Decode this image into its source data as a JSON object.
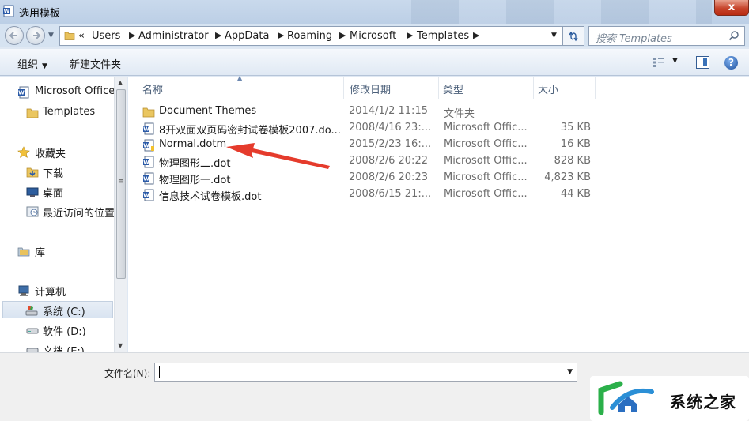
{
  "window": {
    "title": "选用模板",
    "close_label": "x"
  },
  "address": {
    "overflow": "«",
    "crumbs": [
      "Users",
      "Administrator",
      "AppData",
      "Roaming",
      "Microsoft",
      "Templates"
    ],
    "search_placeholder": "搜索 Templates"
  },
  "toolbar": {
    "organize": "组织",
    "new_folder": "新建文件夹",
    "help": "?"
  },
  "nav": {
    "items": [
      {
        "label": "Microsoft Office",
        "icon": "word-doc-icon"
      },
      {
        "label": "Templates",
        "icon": "folder-icon"
      },
      {
        "label": "收藏夹",
        "icon": "star-icon"
      },
      {
        "label": "下载",
        "icon": "download-folder-icon"
      },
      {
        "label": "桌面",
        "icon": "desktop-icon"
      },
      {
        "label": "最近访问的位置",
        "icon": "recent-places-icon"
      },
      {
        "label": "库",
        "icon": "library-icon"
      },
      {
        "label": "计算机",
        "icon": "computer-icon"
      },
      {
        "label": "系统 (C:)",
        "icon": "system-drive-icon"
      },
      {
        "label": "软件 (D:)",
        "icon": "drive-icon"
      },
      {
        "label": "文档 (E:)",
        "icon": "drive-icon"
      }
    ],
    "selected": "系统 (C:)"
  },
  "columns": {
    "name": "名称",
    "date": "修改日期",
    "type": "类型",
    "size": "大小"
  },
  "files": [
    {
      "name": "Document Themes",
      "date": "2014/1/2 11:15",
      "type": "文件夹",
      "size": "",
      "icon": "folder-icon"
    },
    {
      "name": "8开双面双页码密封试卷模板2007.do...",
      "date": "2008/4/16 23:...",
      "type": "Microsoft Offic...",
      "size": "35 KB",
      "icon": "word-doc-icon"
    },
    {
      "name": "Normal.dotm",
      "date": "2015/2/23 16:...",
      "type": "Microsoft Offic...",
      "size": "16 KB",
      "icon": "word-macro-doc-icon"
    },
    {
      "name": "物理图形二.dot",
      "date": "2008/2/6 20:22",
      "type": "Microsoft Offic...",
      "size": "828 KB",
      "icon": "word-doc-icon"
    },
    {
      "name": "物理图形一.dot",
      "date": "2008/2/6 20:23",
      "type": "Microsoft Offic...",
      "size": "4,823 KB",
      "icon": "word-doc-icon"
    },
    {
      "name": "信息技术试卷模板.dot",
      "date": "2008/6/15 21:...",
      "type": "Microsoft Offic...",
      "size": "44 KB",
      "icon": "word-doc-icon"
    }
  ],
  "filename": {
    "label": "文件名(N):",
    "value": ""
  },
  "watermark": {
    "text": "系统之家"
  },
  "colors": {
    "annotation_arrow": "#e53b2c",
    "selection": "#d9e4f1",
    "accent": "#2b5b9d"
  }
}
